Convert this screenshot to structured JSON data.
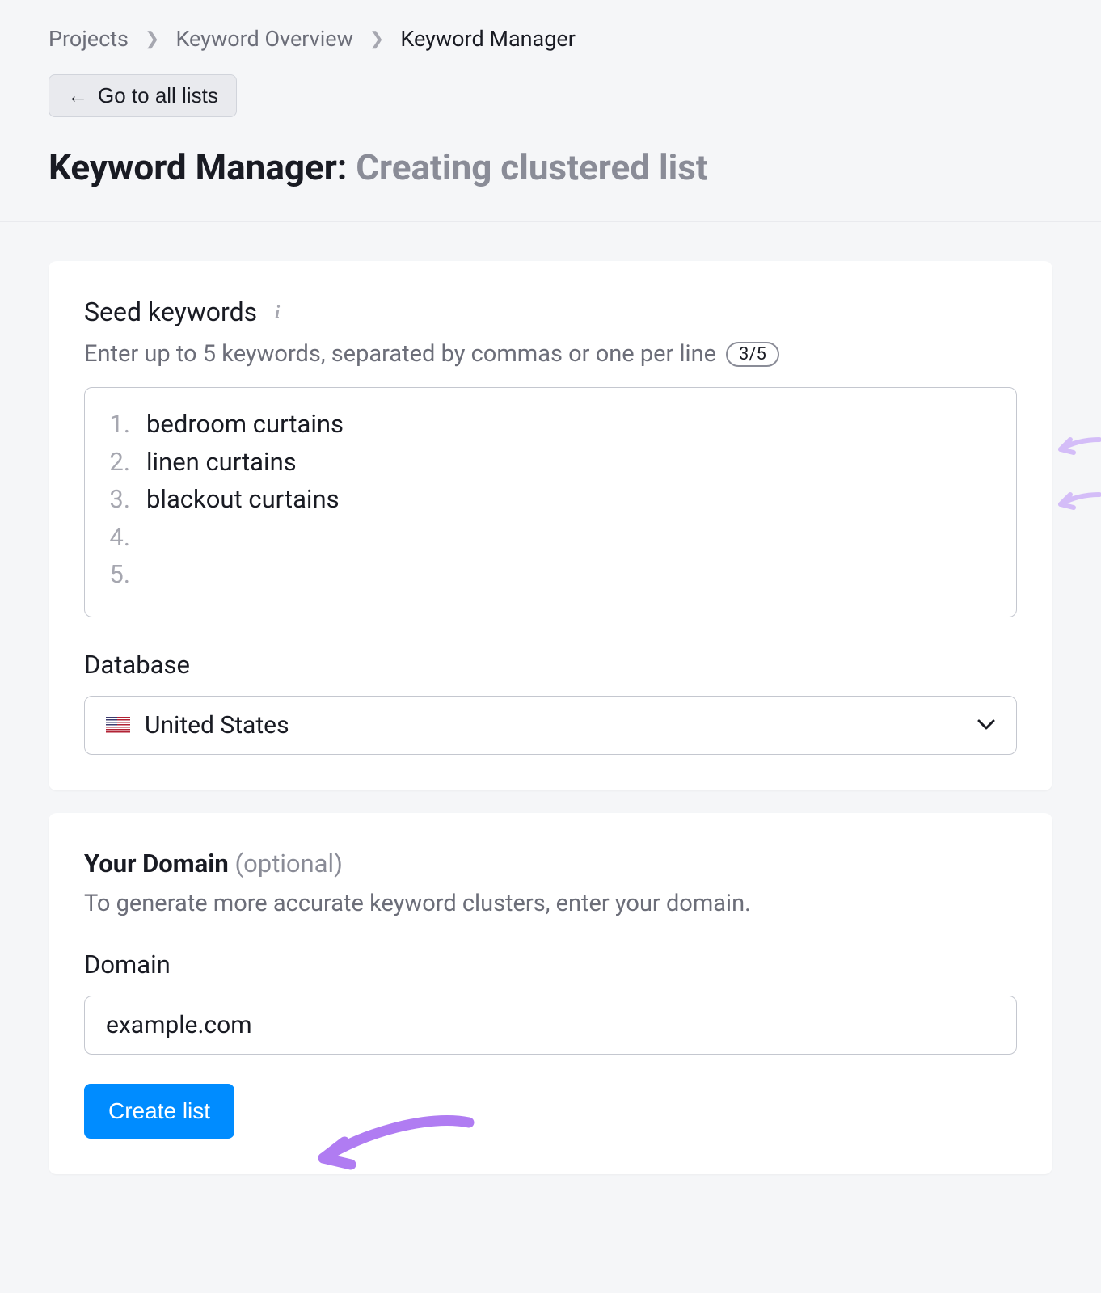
{
  "breadcrumb": {
    "items": [
      "Projects",
      "Keyword Overview",
      "Keyword Manager"
    ]
  },
  "back_button": "Go to all lists",
  "title": {
    "prefix": "Keyword Manager:",
    "suffix": "Creating clustered list"
  },
  "seed": {
    "heading": "Seed keywords",
    "hint": "Enter up to 5 keywords, separated by commas or one per line",
    "count_badge": "3/5",
    "keywords": [
      "bedroom curtains",
      "linen curtains",
      "blackout curtains",
      "",
      ""
    ]
  },
  "database": {
    "label": "Database",
    "selected": "United States"
  },
  "domain_section": {
    "title_bold": "Your Domain",
    "title_optional": "(optional)",
    "hint": "To generate more accurate keyword clusters, enter your domain.",
    "label": "Domain",
    "value": "example.com"
  },
  "create_button": "Create list"
}
